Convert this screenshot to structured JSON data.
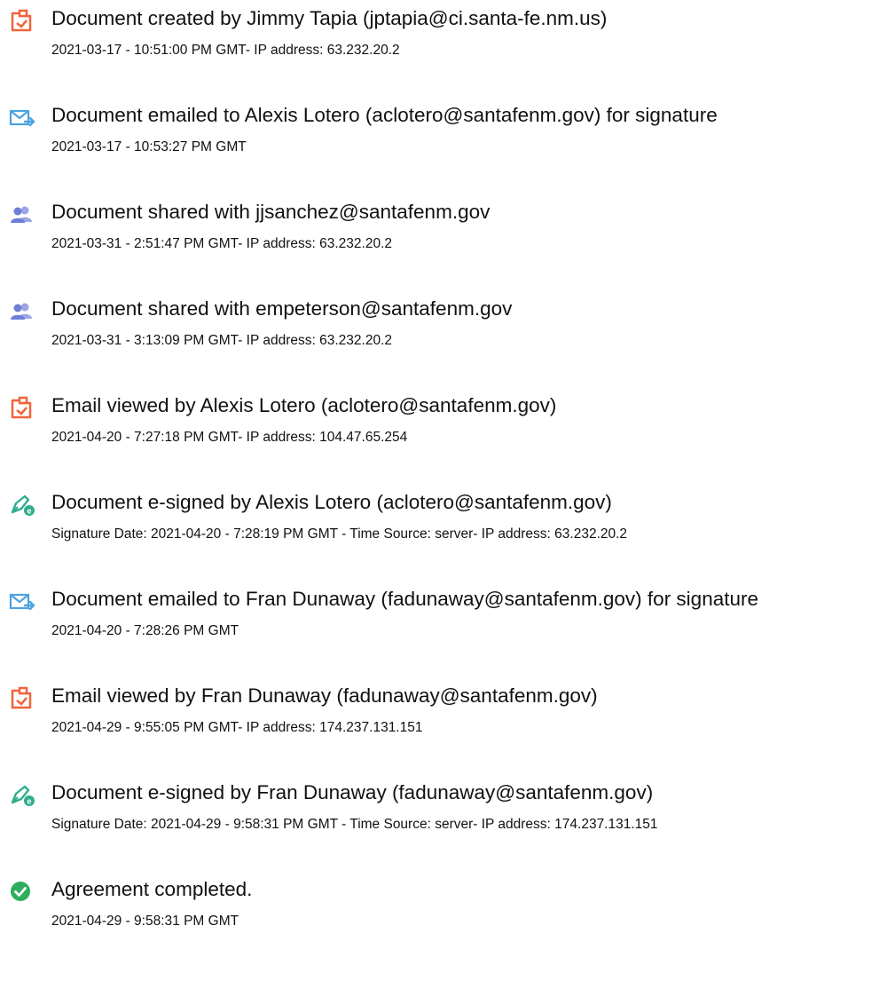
{
  "entries": [
    {
      "icon": "document-icon",
      "title": "Document created by Jimmy Tapia (jptapia@ci.santa-fe.nm.us)",
      "detail": "2021-03-17 - 10:51:00 PM GMT- IP address: 63.232.20.2"
    },
    {
      "icon": "email-sent-icon",
      "title": "Document emailed to Alexis Lotero (aclotero@santafenm.gov) for signature",
      "detail": "2021-03-17 - 10:53:27 PM GMT"
    },
    {
      "icon": "users-icon",
      "title": "Document shared with jjsanchez@santafenm.gov",
      "detail": "2021-03-31 - 2:51:47 PM GMT- IP address: 63.232.20.2"
    },
    {
      "icon": "users-icon",
      "title": "Document shared with empeterson@santafenm.gov",
      "detail": "2021-03-31 - 3:13:09 PM GMT- IP address: 63.232.20.2"
    },
    {
      "icon": "document-icon",
      "title": "Email viewed by Alexis Lotero (aclotero@santafenm.gov)",
      "detail": "2021-04-20 - 7:27:18 PM GMT- IP address: 104.47.65.254"
    },
    {
      "icon": "pen-sign-icon",
      "title": "Document e-signed by Alexis Lotero (aclotero@santafenm.gov)",
      "detail": "Signature Date: 2021-04-20 - 7:28:19 PM GMT - Time Source: server- IP address: 63.232.20.2"
    },
    {
      "icon": "email-sent-icon",
      "title": "Document emailed to Fran Dunaway (fadunaway@santafenm.gov) for signature",
      "detail": "2021-04-20 - 7:28:26 PM GMT"
    },
    {
      "icon": "document-icon",
      "title": "Email viewed by Fran Dunaway (fadunaway@santafenm.gov)",
      "detail": "2021-04-29 - 9:55:05 PM GMT- IP address: 174.237.131.151"
    },
    {
      "icon": "pen-sign-icon",
      "title": "Document e-signed by Fran Dunaway (fadunaway@santafenm.gov)",
      "detail": "Signature Date: 2021-04-29 - 9:58:31 PM GMT - Time Source: server- IP address: 174.237.131.151"
    },
    {
      "icon": "check-circle-icon",
      "title": "Agreement completed.",
      "detail": "2021-04-29 - 9:58:31 PM GMT"
    }
  ],
  "colors": {
    "document": "#f0643c",
    "email": "#4aa3df",
    "users": "#6f7fd6",
    "pen": "#2fae8e",
    "check": "#2eae5c"
  }
}
